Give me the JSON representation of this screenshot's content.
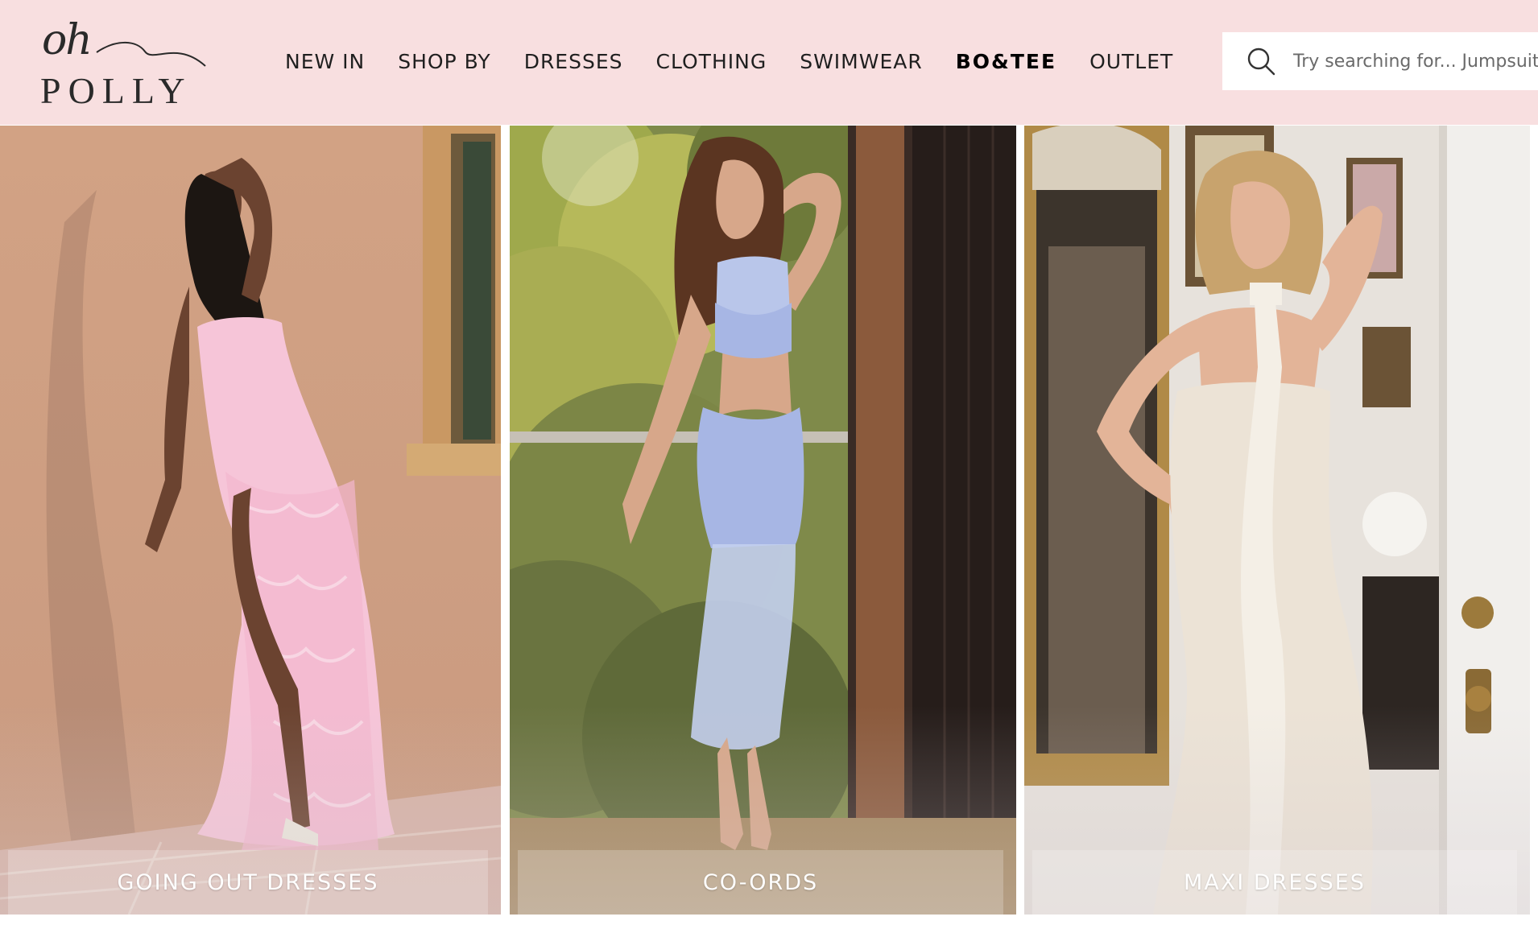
{
  "brand": {
    "script": "oh",
    "wordmark": "POLLY"
  },
  "nav": {
    "items": [
      {
        "label": "NEW IN"
      },
      {
        "label": "SHOP BY"
      },
      {
        "label": "DRESSES"
      },
      {
        "label": "CLOTHING"
      },
      {
        "label": "SWIMWEAR"
      },
      {
        "label": "BO&TEE"
      },
      {
        "label": "OUTLET"
      }
    ]
  },
  "search": {
    "placeholder": "Try searching for... Jumpsuits",
    "icon": "search-icon"
  },
  "tiles": [
    {
      "label": "GOING OUT DRESSES",
      "dress_color": "#f6c5d8"
    },
    {
      "label": "CO-ORDS",
      "dress_color": "#b9c6ea"
    },
    {
      "label": "MAXI DRESSES",
      "dress_color": "#ece3d6"
    }
  ],
  "colors": {
    "header_bg": "#f8dfe0",
    "text": "#1f1f1f"
  }
}
